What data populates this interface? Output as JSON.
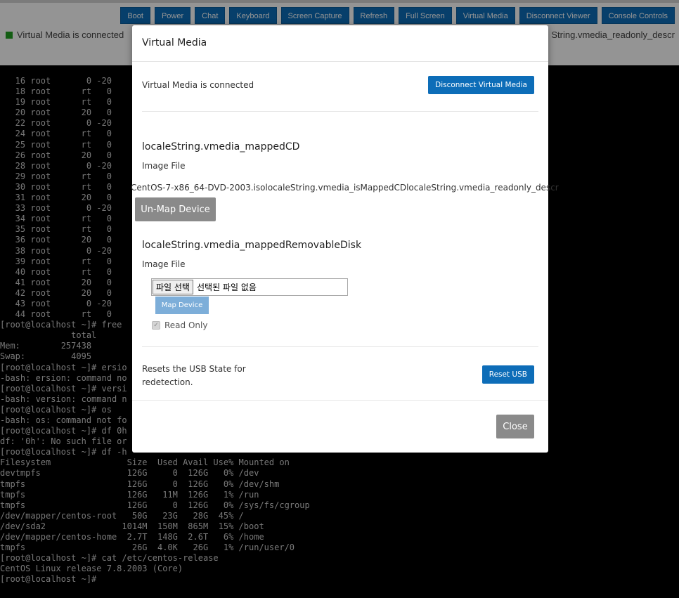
{
  "toolbar": [
    "Boot",
    "Power",
    "Chat",
    "Keyboard",
    "Screen Capture",
    "Refresh",
    "Full Screen",
    "Virtual Media",
    "Disconnect Viewer",
    "Console Controls"
  ],
  "status": {
    "left_text": "Virtual Media is connected",
    "right_text": "String.vmedia_readonly_descr",
    "indicator_color": "#22a022"
  },
  "console_lines": [
    "   16 root       0 -20",
    "   18 root      rt   0",
    "   19 root      rt   0",
    "   20 root      20   0",
    "   22 root       0 -20",
    "   24 root      rt   0",
    "   25 root      rt   0",
    "   26 root      20   0",
    "   28 root       0 -20",
    "   29 root      rt   0",
    "   30 root      rt   0",
    "   31 root      20   0",
    "   33 root       0 -20",
    "   34 root      rt   0",
    "   35 root      rt   0",
    "   36 root      20   0",
    "   38 root       0 -20",
    "   39 root      rt   0",
    "   40 root      rt   0",
    "   41 root      20   0",
    "   42 root      20   0",
    "   43 root       0 -20",
    "   44 root      rt   0",
    "[root@localhost ~]# free",
    "              total",
    "Mem:        257438",
    "Swap:         4095",
    "[root@localhost ~]# ersio",
    "-bash: ersion: command no",
    "[root@localhost ~]# versi",
    "-bash: version: command n",
    "[root@localhost ~]# os",
    "-bash: os: command not fo",
    "[root@localhost ~]# df 0h",
    "df: '0h': No such file or",
    "[root@localhost ~]# df -h",
    "Filesystem               Size  Used Avail Use% Mounted on",
    "devtmpfs                 126G     0  126G   0% /dev",
    "tmpfs                    126G     0  126G   0% /dev/shm",
    "tmpfs                    126G   11M  126G   1% /run",
    "tmpfs                    126G     0  126G   0% /sys/fs/cgroup",
    "/dev/mapper/centos-root   50G   23G   28G  45% /",
    "/dev/sda2               1014M  150M  865M  15% /boot",
    "/dev/mapper/centos-home  2.7T  148G  2.6T   6% /home",
    "tmpfs                     26G  4.0K   26G   1% /run/user/0",
    "[root@localhost ~]# cat /etc/centos-release",
    "CentOS Linux release 7.8.2003 (Core)",
    "[root@localhost ~]#"
  ],
  "modal": {
    "title": "Virtual Media",
    "connected_text": "Virtual Media is connected",
    "disconnect_label": "Disconnect Virtual Media",
    "cd_title": "localeString.vmedia_mappedCD",
    "cd_image_label": "Image File",
    "cd_path": "CentOS-7-x86_64-DVD-2003.isolocaleString.vmedia_isMappedCDlocaleString.vmedia_readonly_descr",
    "unmap_label": "Un-Map Device",
    "rd_title": "localeString.vmedia_mappedRemovableDisk",
    "rd_image_label": "Image File",
    "file_choose_label": "파일 선택",
    "file_none_label": "선택된 파일 없음",
    "map_label": "Map Device",
    "readonly_label": "Read Only",
    "readonly_checked": true,
    "reset_text": "Resets the USB State for redetection.",
    "reset_label": "Reset USB",
    "close_label": "Close"
  }
}
